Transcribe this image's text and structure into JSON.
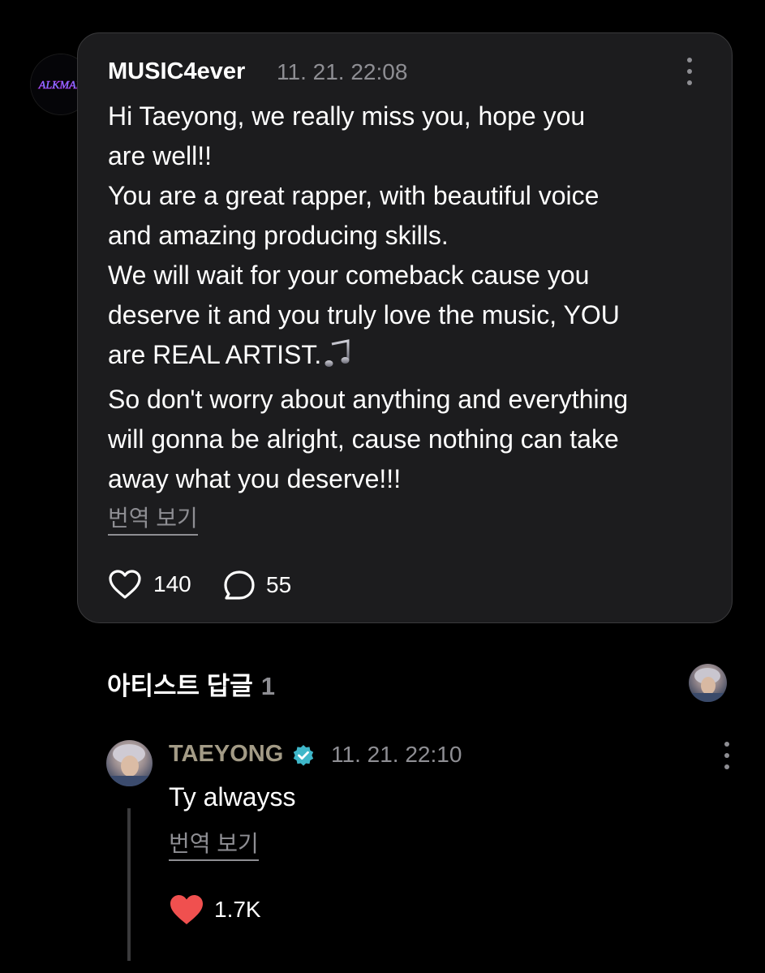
{
  "post": {
    "username": "MUSIC4ever",
    "timestamp": "11. 21. 22:08",
    "avatar_text": "ALKMAR",
    "lines": [
      "Hi Taeyong, we really miss you, hope you",
      "are well!!",
      "You are a great rapper, with beautiful voice",
      "and amazing producing skills.",
      "We will wait for your comeback cause you",
      "deserve it and you truly love the music, YOU",
      "are REAL ARTIST.",
      "So don't worry about anything and everything",
      "will gonna be alright, cause nothing can take",
      "away what you deserve!!!"
    ],
    "translate_label": "번역 보기",
    "likes": "140",
    "comments": "55"
  },
  "artist_replies": {
    "title": "아티스트 답글",
    "count": "1"
  },
  "reply": {
    "username": "TAEYONG",
    "timestamp": "11. 21. 22:10",
    "text": "Ty alwayss",
    "translate_label": "번역 보기",
    "likes": "1.7K"
  },
  "colors": {
    "card_bg": "#1c1c1e",
    "artist_name": "#a39b86",
    "verified_badge": "#3fb7c9",
    "liked_heart": "#f0504f"
  },
  "icons": [
    "more-vertical-icon",
    "music-note-icon",
    "heart-outline-icon",
    "comment-bubble-icon",
    "verified-badge-icon",
    "heart-filled-icon"
  ]
}
